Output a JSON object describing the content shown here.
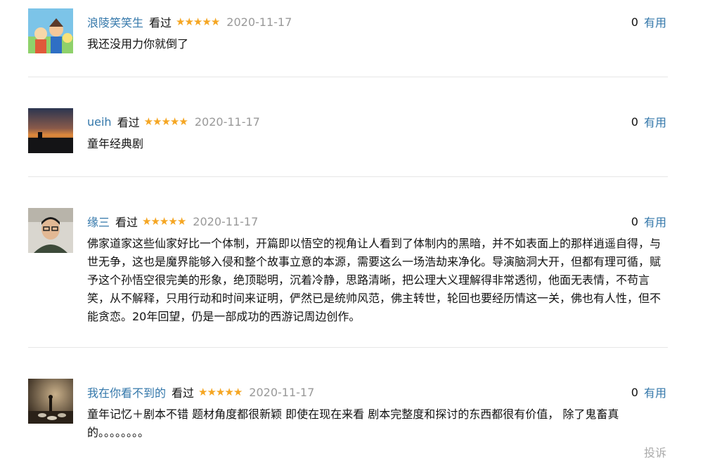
{
  "comments": [
    {
      "username": "浪陵笑笑生",
      "status": "看过",
      "stars": "★★★★★",
      "date": "2020-11-17",
      "vote_count": "0",
      "vote_label": "有用",
      "text": "我还没用力你就倒了"
    },
    {
      "username": "ueih",
      "status": "看过",
      "stars": "★★★★★",
      "date": "2020-11-17",
      "vote_count": "0",
      "vote_label": "有用",
      "text": "童年经典剧"
    },
    {
      "username": "缘三",
      "status": "看过",
      "stars": "★★★★★",
      "date": "2020-11-17",
      "vote_count": "0",
      "vote_label": "有用",
      "text": "佛家道家这些仙家好比一个体制，开篇即以悟空的视角让人看到了体制内的黑暗，并不如表面上的那样逍遥自得，与世无争，这也是魔界能够入侵和整个故事立意的本源，需要这么一场浩劫来净化。导演脑洞大开，但都有理可循，赋予这个孙悟空很完美的形象，绝顶聪明，沉着冷静，思路清晰，把公理大义理解得非常透彻，他面无表情，不苟言笑，从不解释，只用行动和时间来证明，俨然已是统帅风范，佛主转世，轮回也要经历情这一关，佛也有人性，但不能贪恋。20年回望，仍是一部成功的西游记周边创作。"
    },
    {
      "username": "我在你看不到的",
      "status": "看过",
      "stars": "★★★★★",
      "date": "2020-11-17",
      "vote_count": "0",
      "vote_label": "有用",
      "text": "童年记忆＋剧本不错 题材角度都很新颖 即使在现在来看 剧本完整度和探讨的东西都很有价值， 除了鬼畜真的。。。。。。。。"
    }
  ],
  "report_label": "投诉",
  "colors": {
    "link": "#3377aa",
    "star": "#f5a623",
    "date": "#999999",
    "divider": "#e6e6e6"
  }
}
